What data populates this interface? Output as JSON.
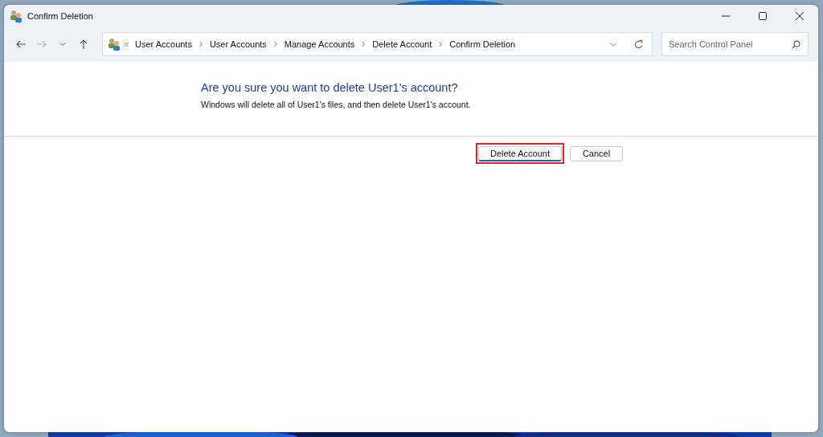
{
  "window": {
    "title": "Confirm Deletion"
  },
  "nav": {
    "forward_disabled": true
  },
  "breadcrumb": [
    "User Accounts",
    "User Accounts",
    "Manage Accounts",
    "Delete Account",
    "Confirm Deletion"
  ],
  "search": {
    "placeholder": "Search Control Panel"
  },
  "heading": "Are you sure you want to delete User1's account?",
  "message": "Windows will delete all of User1's files, and then delete User1's account.",
  "buttons": [
    {
      "label": "Delete Account",
      "focused": true,
      "highlighted": true
    },
    {
      "label": "Cancel",
      "focused": false,
      "highlighted": false
    }
  ]
}
